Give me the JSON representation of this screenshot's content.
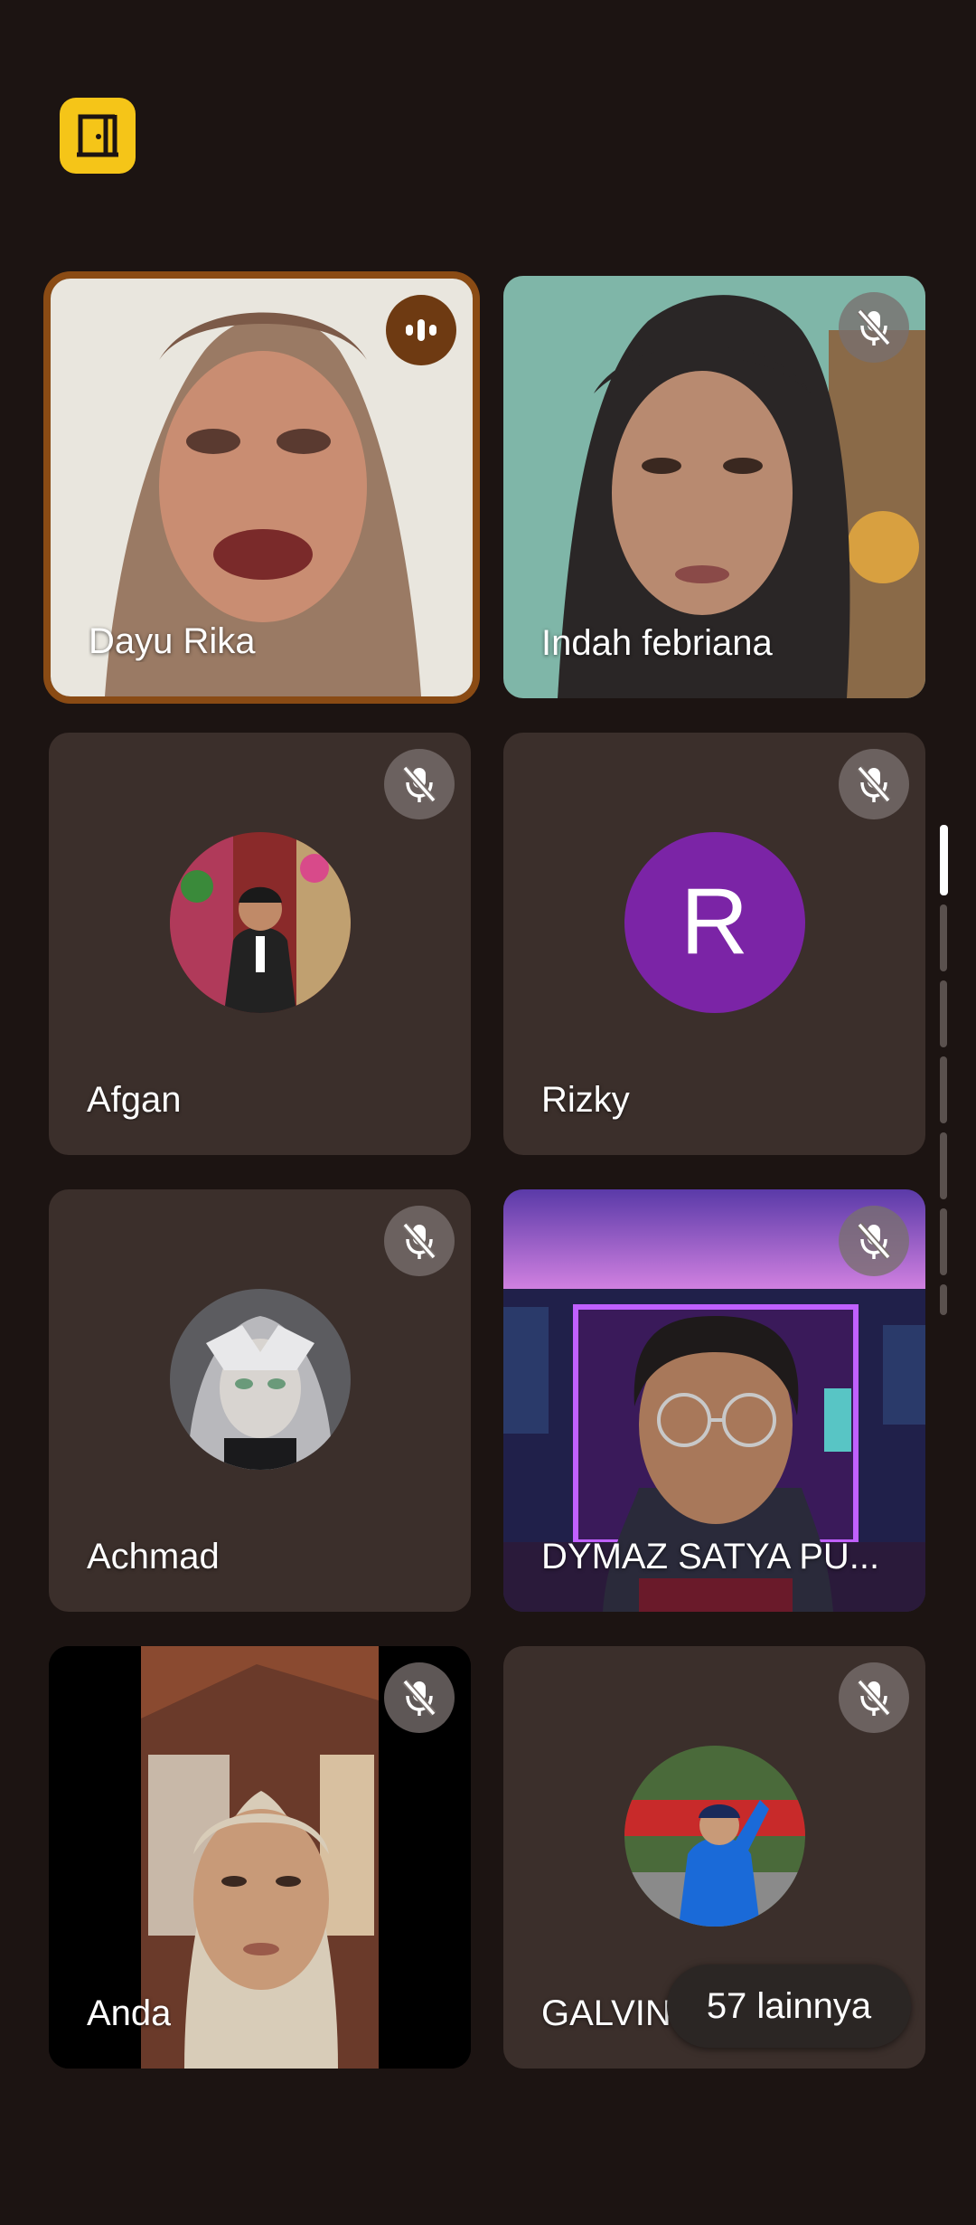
{
  "header": {
    "leave_icon": "door-exit-icon",
    "leave_color": "#f5c518"
  },
  "participants": [
    {
      "name": "Dayu Rika",
      "status": "speaking",
      "media": "video",
      "status_icon": "audio-wave-icon"
    },
    {
      "name": "Indah febriana",
      "status": "muted",
      "media": "video",
      "status_icon": "mic-off-icon"
    },
    {
      "name": "Afgan",
      "status": "muted",
      "media": "avatar-photo",
      "status_icon": "mic-off-icon"
    },
    {
      "name": "Rizky",
      "status": "muted",
      "media": "avatar-letter",
      "avatar_letter": "R",
      "avatar_color": "#7b24a6",
      "status_icon": "mic-off-icon"
    },
    {
      "name": "Achmad",
      "status": "muted",
      "media": "avatar-photo",
      "status_icon": "mic-off-icon"
    },
    {
      "name": "DYMAZ SATYA PU...",
      "status": "muted",
      "media": "video",
      "status_icon": "mic-off-icon"
    },
    {
      "name": "Anda",
      "status": "muted",
      "media": "video",
      "status_icon": "mic-off-icon"
    },
    {
      "name": "GALVIN",
      "status": "muted",
      "media": "avatar-photo",
      "status_icon": "mic-off-icon"
    }
  ],
  "more": {
    "label": "57 lainnya"
  },
  "colors": {
    "background": "#1c1412",
    "tile": "#3b2f2b",
    "speaking_border": "#8a4b14"
  }
}
